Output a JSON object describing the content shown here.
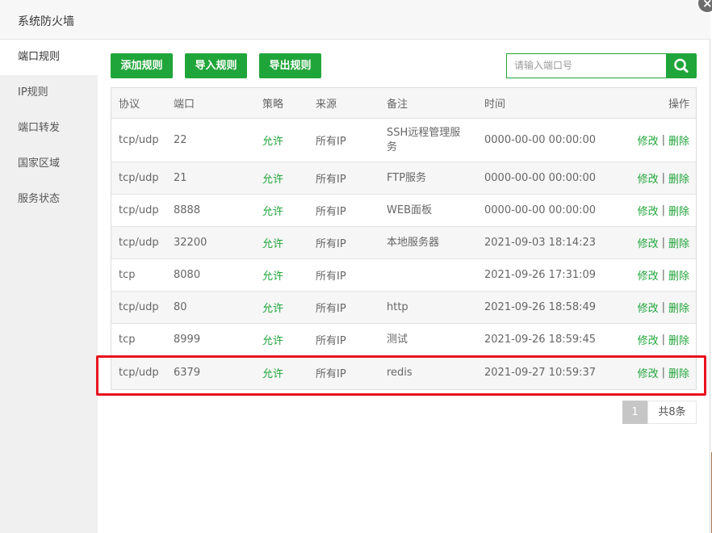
{
  "window": {
    "title": "系统防火墙"
  },
  "close_icon": "×",
  "sidebar": {
    "items": [
      {
        "label": "端口规则",
        "active": true
      },
      {
        "label": "IP规则",
        "active": false
      },
      {
        "label": "端口转发",
        "active": false
      },
      {
        "label": "国家区域",
        "active": false
      },
      {
        "label": "服务状态",
        "active": false
      }
    ]
  },
  "toolbar": {
    "add_label": "添加规则",
    "import_label": "导入规则",
    "export_label": "导出规则",
    "search_placeholder": "请输入端口号",
    "search_icon": "search-icon"
  },
  "table": {
    "headers": [
      "协议",
      "端口",
      "策略",
      "来源",
      "备注",
      "时间",
      "操作"
    ],
    "rows": [
      {
        "protocol": "tcp/udp",
        "port": "22",
        "policy": "允许",
        "source": "所有IP",
        "note": "SSH远程管理服务",
        "time": "0000-00-00 00:00:00",
        "edit": "修改",
        "sep": "|",
        "delete": "删除"
      },
      {
        "protocol": "tcp/udp",
        "port": "21",
        "policy": "允许",
        "source": "所有IP",
        "note": "FTP服务",
        "time": "0000-00-00 00:00:00",
        "edit": "修改",
        "sep": "|",
        "delete": "删除"
      },
      {
        "protocol": "tcp/udp",
        "port": "8888",
        "policy": "允许",
        "source": "所有IP",
        "note": "WEB面板",
        "time": "0000-00-00 00:00:00",
        "edit": "修改",
        "sep": "|",
        "delete": "删除"
      },
      {
        "protocol": "tcp/udp",
        "port": "32200",
        "policy": "允许",
        "source": "所有IP",
        "note": "本地服务器",
        "time": "2021-09-03 18:14:23",
        "edit": "修改",
        "sep": "|",
        "delete": "删除"
      },
      {
        "protocol": "tcp",
        "port": "8080",
        "policy": "允许",
        "source": "所有IP",
        "note": "",
        "time": "2021-09-26 17:31:09",
        "edit": "修改",
        "sep": "|",
        "delete": "删除"
      },
      {
        "protocol": "tcp/udp",
        "port": "80",
        "policy": "允许",
        "source": "所有IP",
        "note": "http",
        "time": "2021-09-26 18:58:49",
        "edit": "修改",
        "sep": "|",
        "delete": "删除"
      },
      {
        "protocol": "tcp",
        "port": "8999",
        "policy": "允许",
        "source": "所有IP",
        "note": "测试",
        "time": "2021-09-26 18:59:45",
        "edit": "修改",
        "sep": "|",
        "delete": "删除"
      },
      {
        "protocol": "tcp/udp",
        "port": "6379",
        "policy": "允许",
        "source": "所有IP",
        "note": "redis",
        "time": "2021-09-27 10:59:37",
        "edit": "修改",
        "sep": "|",
        "delete": "删除"
      }
    ]
  },
  "pagination": {
    "current_page": "1",
    "total_label": "共8条"
  },
  "colors": {
    "accent": "#20a53a",
    "highlight": "#e8131e"
  }
}
